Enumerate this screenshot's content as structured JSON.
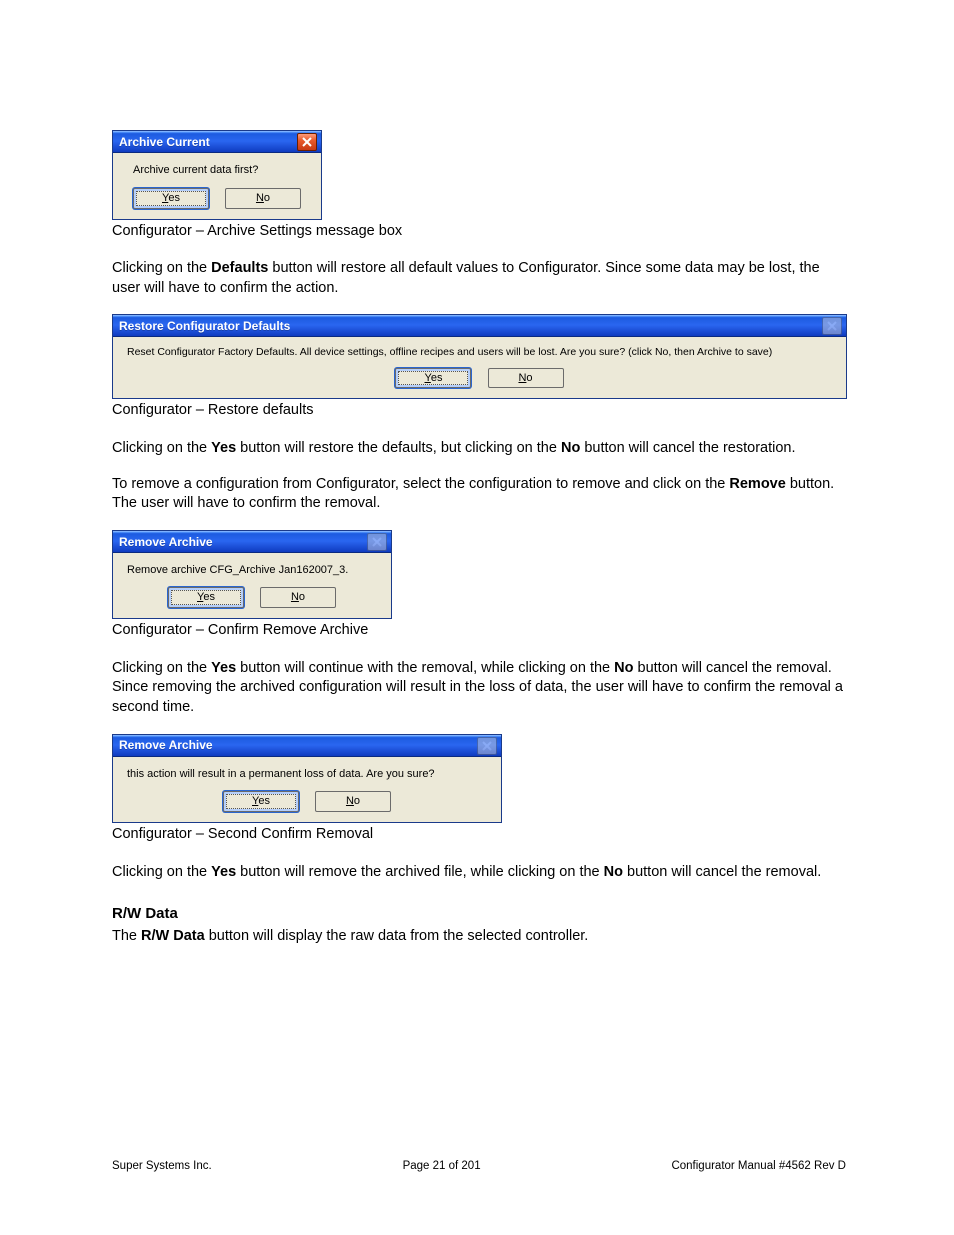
{
  "dialog1": {
    "title": "Archive Current",
    "message": "Archive current data first?",
    "yes": "Yes",
    "no": "No"
  },
  "caption1": "Configurator – Archive Settings message box",
  "para1_a": "Clicking on the ",
  "para1_b": "Defaults",
  "para1_c": " button will restore all default values to Configurator. Since some data may be lost, the user will have to confirm the action.",
  "dialog2": {
    "title": "Restore Configurator Defaults",
    "message": "Reset Configurator Factory Defaults.  All device settings, offline recipes and users will be lost.  Are you sure? (click No, then Archive to save)",
    "yes": "Yes",
    "no": "No"
  },
  "caption2": "Configurator – Restore defaults",
  "para2_a": "Clicking on the ",
  "para2_b": "Yes",
  "para2_c": " button will restore the defaults, but clicking on the ",
  "para2_d": "No",
  "para2_e": " button will cancel the restoration.",
  "para3_a": "To remove a configuration from Configurator, select the configuration to remove and click on the ",
  "para3_b": "Remove",
  "para3_c": " button.  The user will have to confirm the removal.",
  "dialog3": {
    "title": "Remove Archive",
    "message": "Remove archive CFG_Archive Jan162007_3.",
    "yes": "Yes",
    "no": "No"
  },
  "caption3": "Configurator – Confirm Remove Archive",
  "para4_a": "Clicking on the ",
  "para4_b": "Yes",
  "para4_c": " button will continue with the removal, while clicking on the ",
  "para4_d": "No",
  "para4_e": " button will cancel the removal.  Since removing the archived configuration will result in the loss of data, the user will have to confirm the removal a second time.",
  "dialog4": {
    "title": "Remove Archive",
    "message": "this action will result in a permanent loss of data.  Are you sure?",
    "yes": "Yes",
    "no": "No"
  },
  "caption4": "Configurator – Second Confirm Removal",
  "para5_a": "Clicking on the ",
  "para5_b": "Yes",
  "para5_c": " button will remove the archived file, while clicking on the ",
  "para5_d": "No",
  "para5_e": " button will cancel the removal.",
  "heading_rw": "R/W Data",
  "para6_a": "The ",
  "para6_b": "R/W Data",
  "para6_c": " button will display the raw data from the selected controller.",
  "footer": {
    "left": "Super Systems Inc.",
    "center": "Page 21 of 201",
    "right": "Configurator Manual #4562 Rev D"
  }
}
